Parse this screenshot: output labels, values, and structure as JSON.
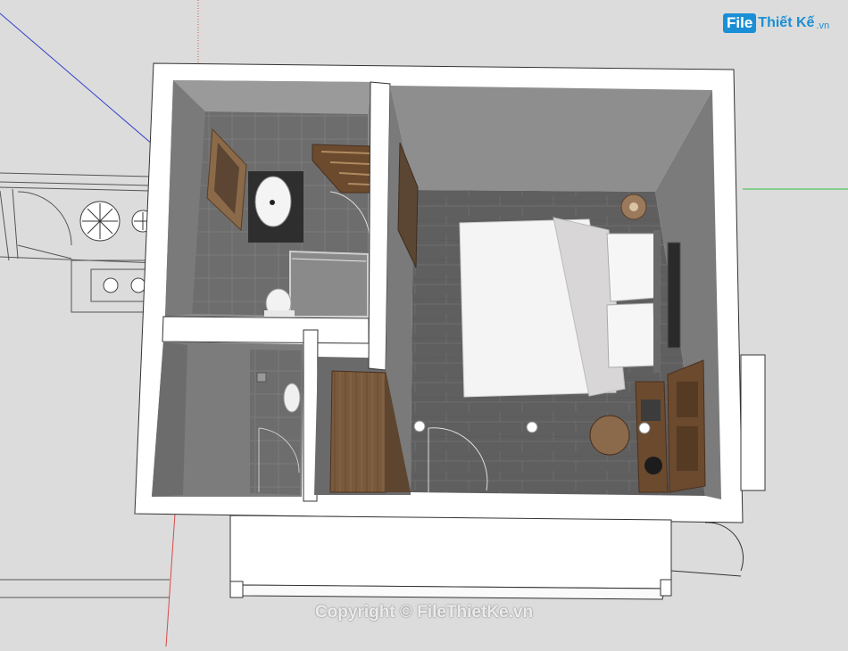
{
  "brand": {
    "logo_box": "File",
    "logo_text": "Thiết Kế",
    "logo_ext": ".vn"
  },
  "watermark": "Copyright © FileThietKe.vn",
  "colors": {
    "background": "#dcdcdc",
    "wall_top": "#ffffff",
    "wall_inner": "#8e8e8e",
    "floor_wood": "#5e5e5e",
    "bath_tile": "#6f6f6f",
    "axis_blue": "#2e3cc8",
    "axis_green": "#2fbf3a",
    "axis_red": "#d84a4a",
    "logo_blue": "#1a8fd6"
  }
}
